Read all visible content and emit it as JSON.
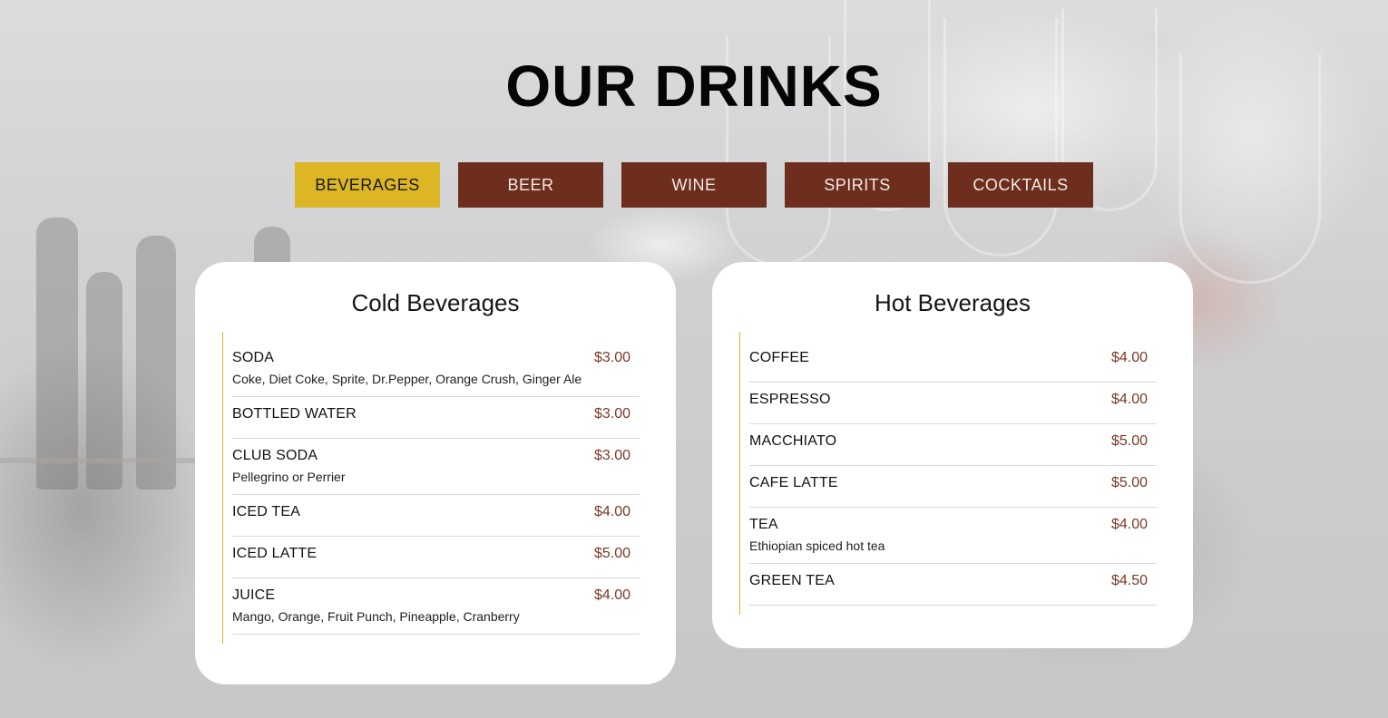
{
  "page": {
    "title": "OUR DRINKS"
  },
  "colors": {
    "accent": "#ddb626",
    "tab_inactive": "#6d2e1e",
    "price": "#7a3a23"
  },
  "tabs": [
    {
      "label": "BEVERAGES",
      "active": true
    },
    {
      "label": "BEER",
      "active": false
    },
    {
      "label": "WINE",
      "active": false
    },
    {
      "label": "SPIRITS",
      "active": false
    },
    {
      "label": "COCKTAILS",
      "active": false
    }
  ],
  "cold": {
    "title": "Cold Beverages",
    "items": [
      {
        "name": "SODA",
        "price": "$3.00",
        "desc": "Coke, Diet Coke, Sprite, Dr.Pepper, Orange Crush, Ginger Ale"
      },
      {
        "name": "BOTTLED WATER",
        "price": "$3.00"
      },
      {
        "name": "CLUB SODA",
        "price": "$3.00",
        "desc": "Pellegrino or Perrier"
      },
      {
        "name": "ICED TEA",
        "price": "$4.00"
      },
      {
        "name": "ICED LATTE",
        "price": "$5.00"
      },
      {
        "name": "JUICE",
        "price": "$4.00",
        "desc": "Mango, Orange, Fruit Punch, Pineapple, Cranberry"
      }
    ]
  },
  "hot": {
    "title": "Hot Beverages",
    "items": [
      {
        "name": "COFFEE",
        "price": "$4.00"
      },
      {
        "name": "ESPRESSO",
        "price": "$4.00"
      },
      {
        "name": "MACCHIATO",
        "price": "$5.00"
      },
      {
        "name": "CAFE LATTE",
        "price": "$5.00"
      },
      {
        "name": "TEA",
        "price": "$4.00",
        "desc": "Ethiopian spiced hot tea"
      },
      {
        "name": "GREEN TEA",
        "price": "$4.50"
      }
    ]
  }
}
